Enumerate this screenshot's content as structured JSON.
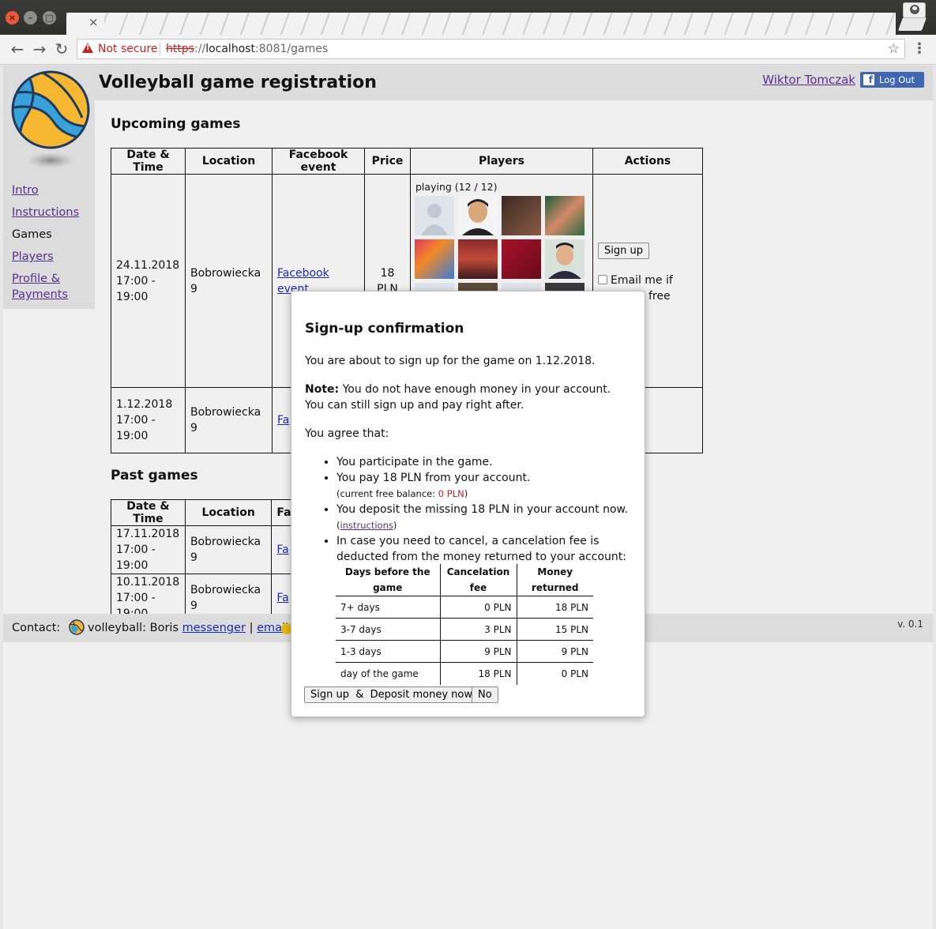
{
  "browser": {
    "tab_close": "×",
    "not_secure": "Not secure",
    "url_scheme": "https",
    "url_rest_host": "localhost",
    "url_rest": ":8081/games"
  },
  "app": {
    "title": "Volleyball game registration",
    "user_name": "Wiktor Tomczak",
    "logout_label": "Log Out"
  },
  "sidebar": {
    "items": [
      {
        "label": "Intro"
      },
      {
        "label": "Instructions"
      },
      {
        "label": "Games"
      },
      {
        "label": "Players"
      },
      {
        "label": "Profile & Payments"
      }
    ]
  },
  "upcoming": {
    "title": "Upcoming games",
    "headers": [
      "Date & Time",
      "Location",
      "Facebook event",
      "Price",
      "Players",
      "Actions"
    ],
    "rows": [
      {
        "date": "24.11.2018",
        "time": "17:00 - 19:00",
        "location": "Bobrowiecka 9",
        "fb": "Facebook event",
        "price": "18 PLN",
        "playing": "playing (12 / 12)",
        "signup": "Sign up",
        "email_me": "Email me if",
        "email_me2": "free"
      },
      {
        "date": "1.12.2018",
        "time": "17:00 - 19:00",
        "location": "Bobrowiecka 9",
        "fb": "Fa"
      }
    ]
  },
  "past": {
    "title": "Past games",
    "headers": [
      "Date & Time",
      "Location",
      "Fa"
    ],
    "rows": [
      {
        "date": "17.11.2018",
        "time": "17:00 - 19:00",
        "location": "Bobrowiecka 9",
        "fb": "Fa"
      },
      {
        "date": "10.11.2018",
        "time": "17:00 - 19:00",
        "location": "Bobrowiecka 9",
        "fb": "Fa"
      }
    ]
  },
  "footer": {
    "contact": "Contact:",
    "volleyball": "volleyball: Boris",
    "messenger": "messenger",
    "sep": "|",
    "email": "email",
    "version": "v. 0.1"
  },
  "modal": {
    "title": "Sign-up confirmation",
    "intro": "You are about to sign up for the game on 1.12.2018.",
    "note_label": "Note:",
    "note_text": "You do not have enough money in your account.",
    "note_text2": "You can still sign up and pay right after.",
    "agree": "You agree that:",
    "bullets": {
      "b1": "You participate in the game.",
      "b2": "You pay 18 PLN from your account.",
      "b2_sub_prefix": "(current free balance: ",
      "b2_sub_value": "0 PLN",
      "b2_sub_suffix": ")",
      "b3": "You deposit the missing 18 PLN in your account now.",
      "b3_link_prefix": "(",
      "b3_link": "instructions",
      "b3_link_suffix": ")",
      "b4": "In case you need to cancel, a cancelation fee is deducted from the money returned to your account:"
    },
    "fee_headers": [
      "Days before the game",
      "Cancelation fee",
      "Money returned"
    ],
    "fee_rows": [
      [
        "7+ days",
        "0 PLN",
        "18 PLN"
      ],
      [
        "3-7 days",
        "3 PLN",
        "15 PLN"
      ],
      [
        "1-3 days",
        "9 PLN",
        "9 PLN"
      ],
      [
        "day of the game",
        "18 PLN",
        "0 PLN"
      ]
    ],
    "confirm_label": "Sign up  &  Deposit money now",
    "no_label": "No"
  },
  "colors": {
    "link": "#1a2ab8",
    "visited_link": "#5b2d8e",
    "warning": "#c5221f",
    "facebook": "#4267b2"
  }
}
